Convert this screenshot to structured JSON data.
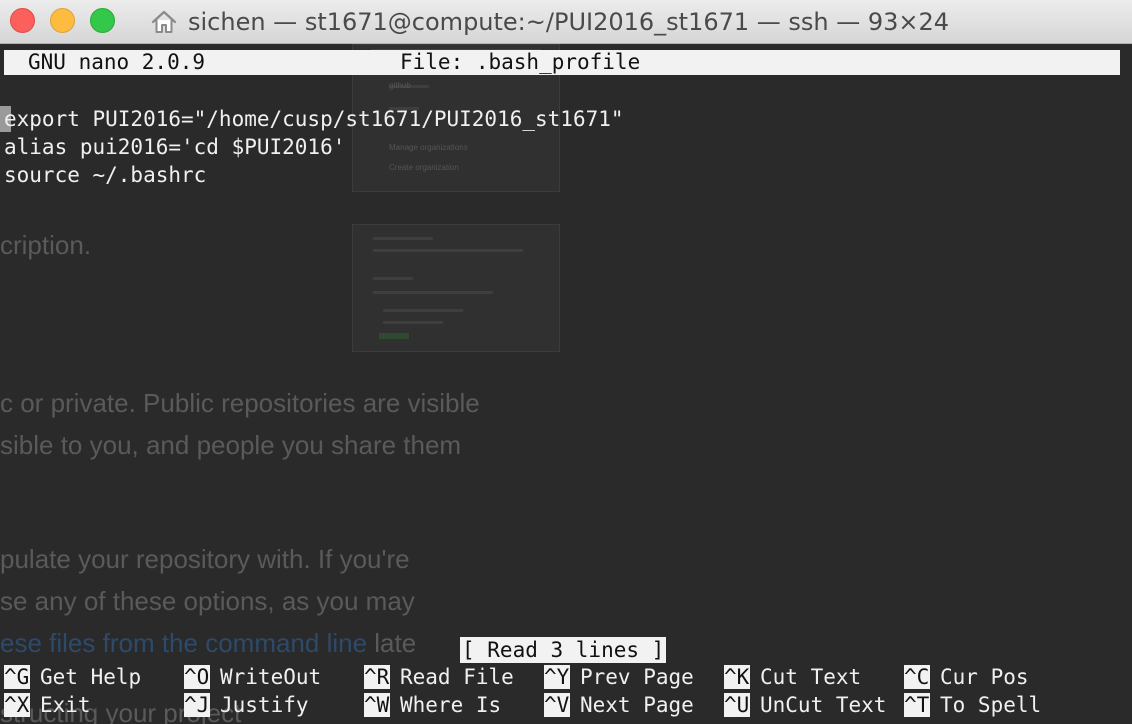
{
  "window": {
    "title": "sichen — st1671@compute:~/PUI2016_st1671 — ssh — 93×24",
    "buttons": {
      "close_glyph": "×",
      "minimize_glyph": "−",
      "maximize_glyph": "+"
    }
  },
  "nano": {
    "version": "GNU nano 2.0.9",
    "file_label": "File: .bash_profile",
    "lines": [
      "export PUI2016=\"/home/cusp/st1671/PUI2016_st1671\"",
      "alias pui2016='cd $PUI2016'",
      "source ~/.bashrc"
    ],
    "status_message": "[ Read 3 lines ]",
    "shortcuts_row1": [
      {
        "key": "^G",
        "label": "Get Help"
      },
      {
        "key": "^O",
        "label": "WriteOut"
      },
      {
        "key": "^R",
        "label": "Read File"
      },
      {
        "key": "^Y",
        "label": "Prev Page"
      },
      {
        "key": "^K",
        "label": "Cut Text"
      },
      {
        "key": "^C",
        "label": "Cur Pos"
      }
    ],
    "shortcuts_row2": [
      {
        "key": "^X",
        "label": "Exit"
      },
      {
        "key": "^J",
        "label": "Justify"
      },
      {
        "key": "^W",
        "label": "Where Is"
      },
      {
        "key": "^V",
        "label": "Next Page"
      },
      {
        "key": "^U",
        "label": "UnCut Text"
      },
      {
        "key": "^T",
        "label": "To Spell"
      }
    ]
  },
  "background_page": {
    "line1": "cription.",
    "line2": "c or private. Public repositories are visible",
    "line3": "sible to you, and people you share them",
    "line4": "pulate your repository with. If you're",
    "line5": "se any of these options, as you may",
    "line6_link": "ese files from the command line",
    "line6_rest": " late",
    "line7": "structing your project",
    "menu_manage": "Manage organizations",
    "menu_create": "Create organization",
    "menu_github": "github"
  },
  "colors": {
    "terminal_bg": "#2a2a2a",
    "terminal_fg": "#f0f0f0",
    "inverse_bg": "#f2f2f2"
  }
}
